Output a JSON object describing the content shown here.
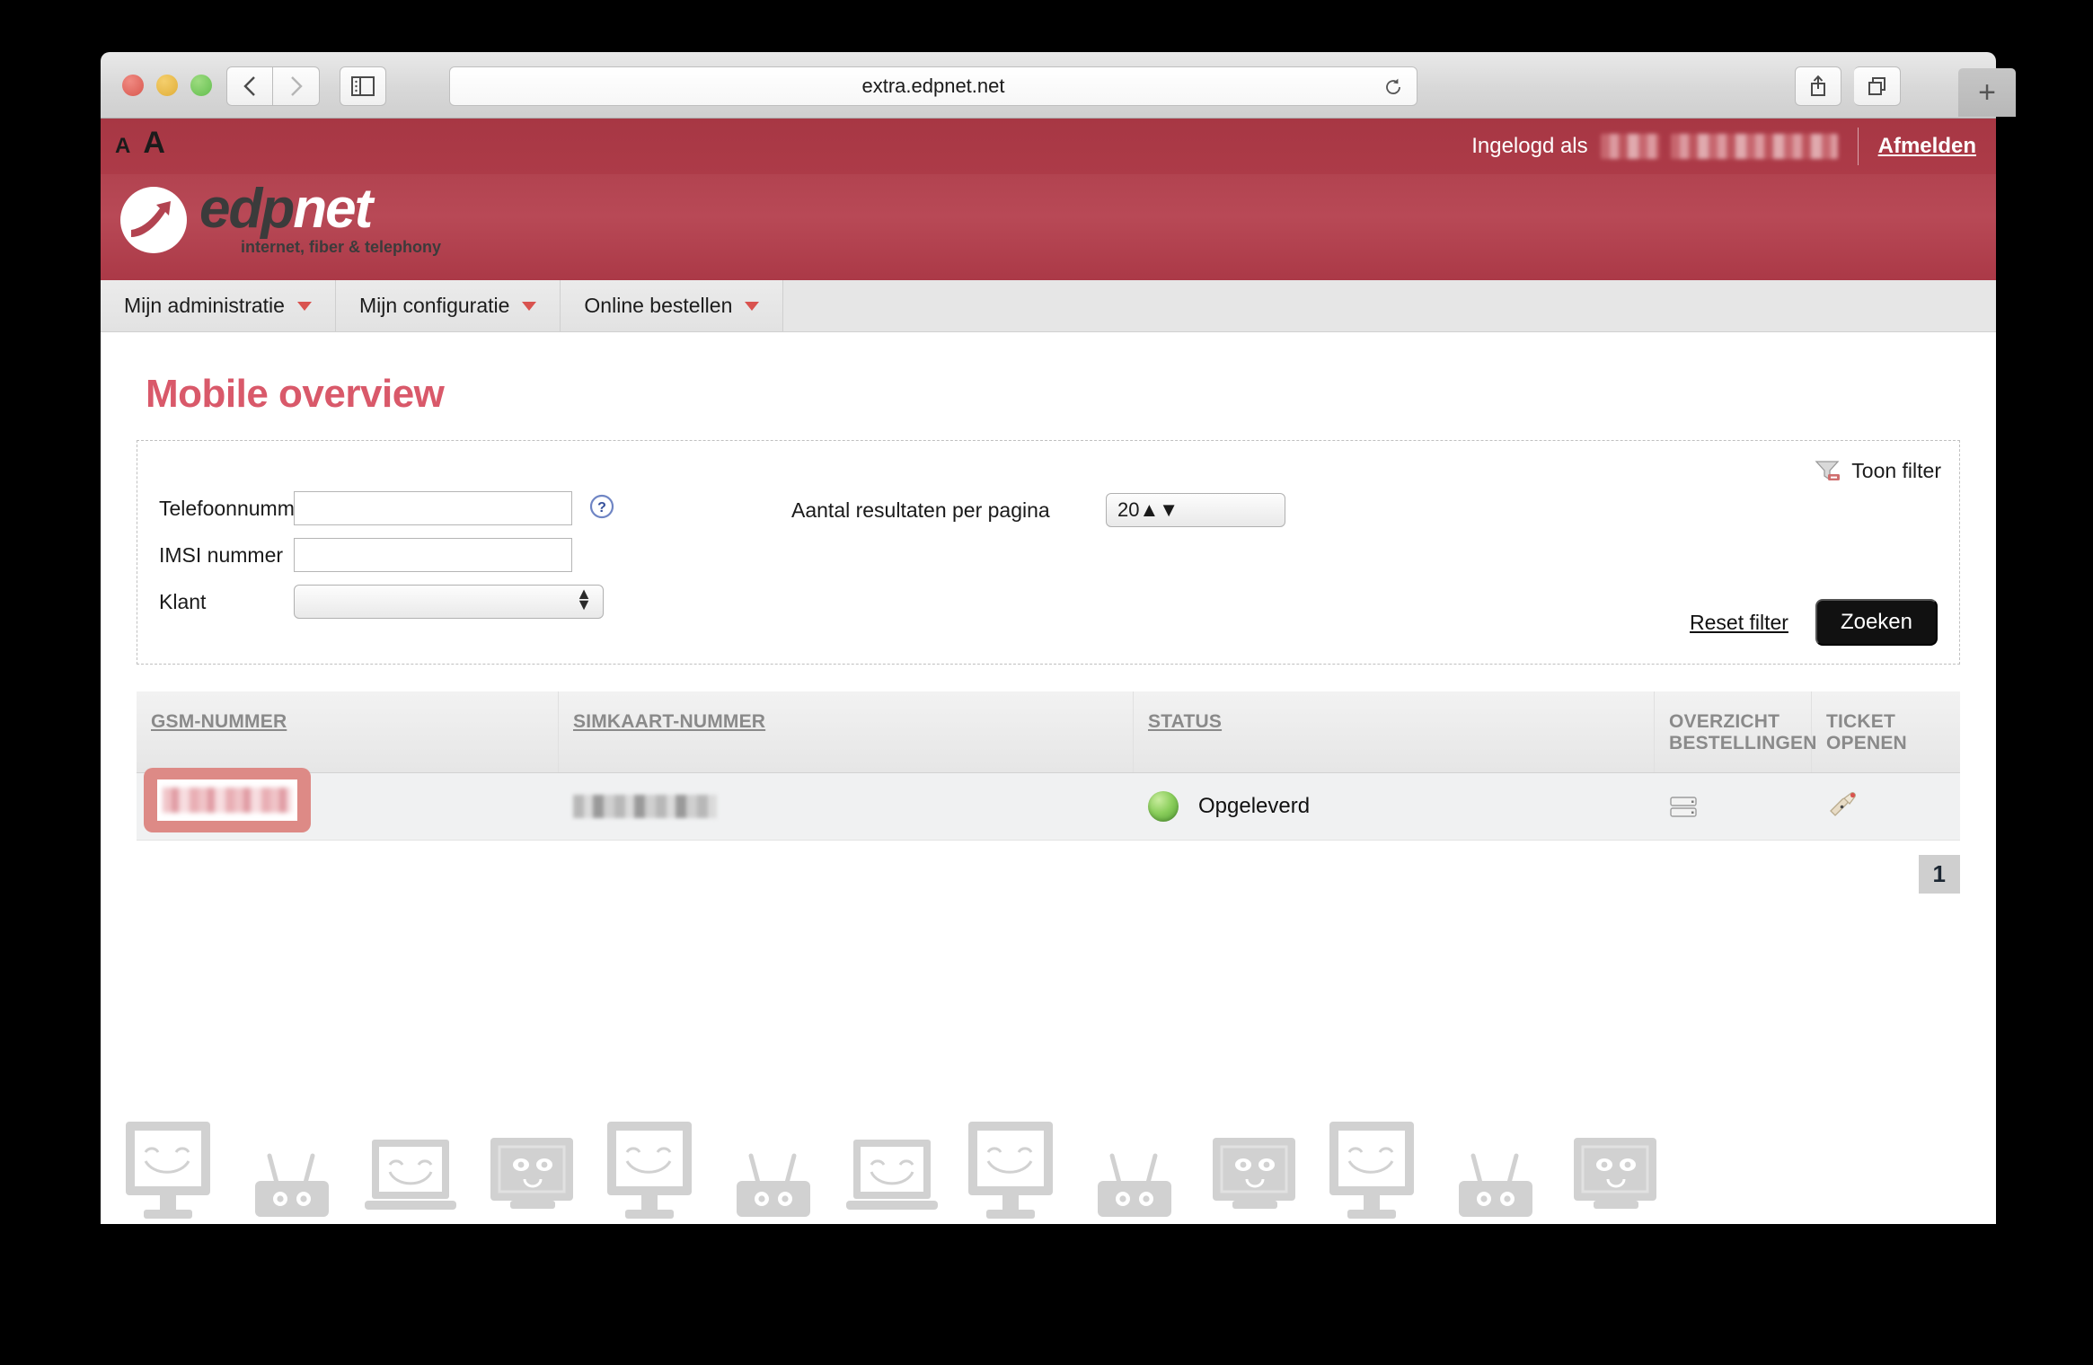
{
  "browser": {
    "url": "extra.edpnet.net",
    "back_icon": "chevron-left-icon",
    "forward_icon": "chevron-right-icon",
    "sidebar_icon": "sidebar-toggle-icon",
    "reload_icon": "reload-icon",
    "share_icon": "share-icon",
    "tabs_icon": "show-all-tabs-icon",
    "new_tab_label": "+"
  },
  "topbar": {
    "text_size_small": "A",
    "text_size_large": "A",
    "logged_in_label": "Ingelogd als",
    "username_redacted": "",
    "logout_label": "Afmelden"
  },
  "brand": {
    "logo_edp": "edp",
    "logo_net": "net",
    "tagline": "internet, fiber & telephony"
  },
  "nav": {
    "items": [
      {
        "label": "Mijn administratie"
      },
      {
        "label": "Mijn configuratie"
      },
      {
        "label": "Online bestellen"
      }
    ]
  },
  "page": {
    "title": "Mobile overview"
  },
  "filter": {
    "toggle_label": "Toon filter",
    "toggle_icon": "funnel-minus-icon",
    "fields": [
      {
        "label": "Telefoonnummer",
        "value": "",
        "placeholder": ""
      },
      {
        "label": "IMSI nummer",
        "value": "",
        "placeholder": ""
      },
      {
        "label": "Klant",
        "value": ""
      }
    ],
    "help_icon": "question-mark-icon",
    "results_per_page_label": "Aantal resultaten per pagina",
    "results_per_page_value": "20",
    "reset_label": "Reset filter",
    "search_label": "Zoeken"
  },
  "table": {
    "columns": [
      {
        "label": "GSM-NUMMER",
        "sortable": true
      },
      {
        "label": "SIMKAART-NUMMER",
        "sortable": true
      },
      {
        "label": "STATUS",
        "sortable": true
      },
      {
        "label": "OVERZICHT BESTELLINGEN",
        "sortable": false
      },
      {
        "label": "TICKET OPENEN",
        "sortable": false
      }
    ],
    "columns_multiline": {
      "orders_line1": "OVERZICHT",
      "orders_line2": "BESTELLINGEN",
      "ticket_line1": "TICKET",
      "ticket_line2": "OPENEN"
    },
    "rows": [
      {
        "gsm_number": "",
        "sim_number": "",
        "status": "Opgeleverd",
        "status_color": "#6fbf45",
        "orders_icon": "order-overview-icon",
        "ticket_icon": "ticket-pencil-icon"
      }
    ]
  },
  "pagination": {
    "current_page": "1"
  },
  "colors": {
    "brand_red": "#b24350",
    "topbar_red": "#a73744",
    "title_pink": "#d9596a",
    "highlight_salmon": "#dd8a86",
    "status_green": "#6fbf45",
    "caret_red": "#d9534f"
  }
}
